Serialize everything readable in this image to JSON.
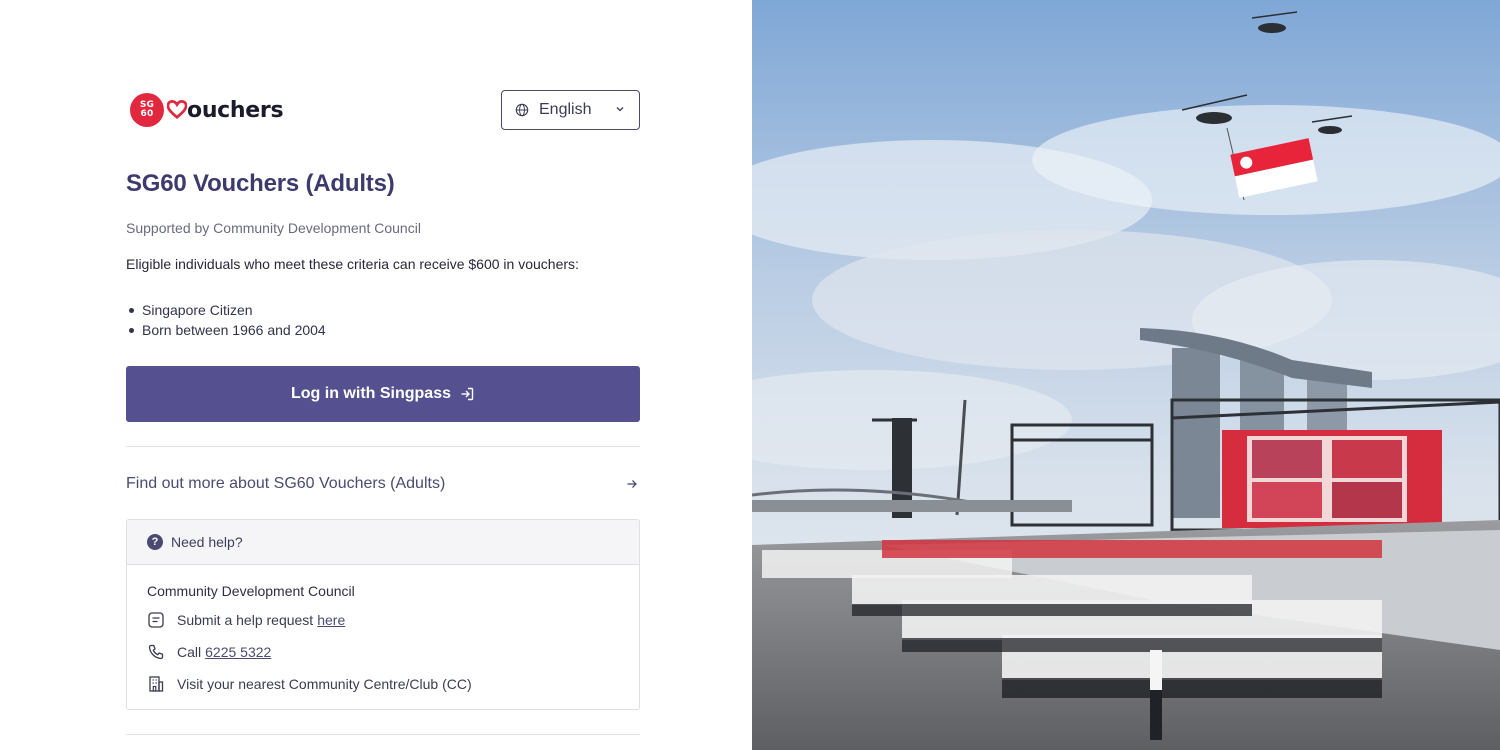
{
  "logo": {
    "badge_line1": "SG",
    "badge_line2": "60",
    "wordmark": "ouchers",
    "colors": {
      "badge": "#e2283f",
      "text": "#1b1b2b"
    }
  },
  "language": {
    "selected": "English",
    "icon": "globe-icon"
  },
  "page": {
    "title": "SG60 Vouchers (Adults)",
    "subtitle": "Supported by Community Development Council",
    "eligibility_intro": "Eligible individuals who meet these criteria can receive $600 in vouchers:",
    "criteria": [
      "Singapore Citizen",
      "Born between 1966 and 2004"
    ]
  },
  "login": {
    "label": "Log in with Singpass",
    "icon": "login-arrow-icon",
    "color": "#55508f"
  },
  "find_more": {
    "label": "Find out more about SG60 Vouchers (Adults)",
    "icon": "arrow-right-icon"
  },
  "help": {
    "heading": "Need help?",
    "organisation": "Community Development Council",
    "request_text": "Submit a help request",
    "request_link": "here",
    "call_text": "Call",
    "call_number": "6225 5322",
    "visit_text": "Visit your nearest Community Centre/Club (CC)"
  },
  "hero_image": {
    "description_icon": "national-day-parade-photo"
  }
}
